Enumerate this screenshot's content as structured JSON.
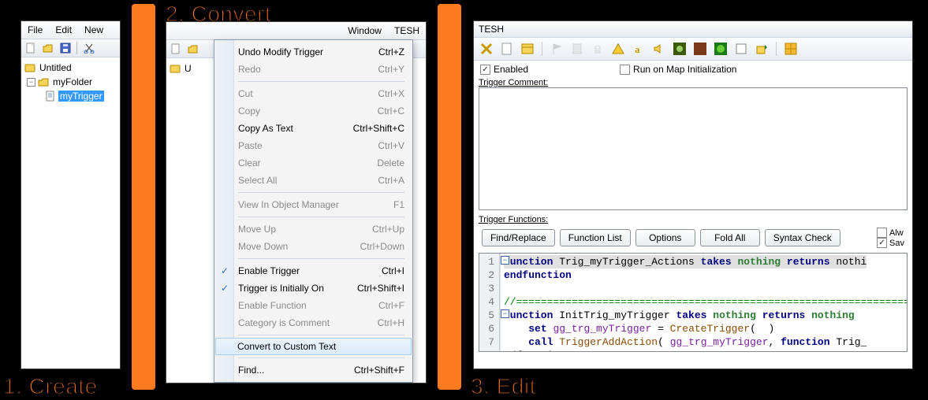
{
  "steps": {
    "s1": "1. Create",
    "s2": "2. Convert",
    "s3": "3. Edit"
  },
  "panel1": {
    "menubar": [
      "File",
      "Edit",
      "New"
    ],
    "tree": {
      "root": "Untitled",
      "folder": "myFolder",
      "trigger": "myTrigger"
    }
  },
  "panel2": {
    "menubar_right": [
      "Window",
      "TESH"
    ],
    "menu": [
      {
        "label": "Undo Modify Trigger",
        "shortcut": "Ctrl+Z",
        "disabled": false
      },
      {
        "label": "Redo",
        "shortcut": "Ctrl+Y",
        "disabled": true
      },
      "---",
      {
        "label": "Cut",
        "shortcut": "Ctrl+X",
        "disabled": true
      },
      {
        "label": "Copy",
        "shortcut": "Ctrl+C",
        "disabled": true
      },
      {
        "label": "Copy As Text",
        "shortcut": "Ctrl+Shift+C",
        "disabled": false
      },
      {
        "label": "Paste",
        "shortcut": "Ctrl+V",
        "disabled": true
      },
      {
        "label": "Clear",
        "shortcut": "Delete",
        "disabled": true
      },
      {
        "label": "Select All",
        "shortcut": "Ctrl+A",
        "disabled": true
      },
      "---",
      {
        "label": "View In Object Manager",
        "shortcut": "F1",
        "disabled": true
      },
      "---",
      {
        "label": "Move Up",
        "shortcut": "Ctrl+Up",
        "disabled": true
      },
      {
        "label": "Move Down",
        "shortcut": "Ctrl+Down",
        "disabled": true
      },
      "---",
      {
        "label": "Enable Trigger",
        "shortcut": "Ctrl+I",
        "disabled": false,
        "checked": true
      },
      {
        "label": "Trigger is Initially On",
        "shortcut": "Ctrl+Shift+I",
        "disabled": false,
        "checked": true
      },
      {
        "label": "Enable Function",
        "shortcut": "Ctrl+F",
        "disabled": true
      },
      {
        "label": "Category is Comment",
        "shortcut": "Ctrl+H",
        "disabled": true
      },
      "---",
      {
        "label": "Convert to Custom Text",
        "shortcut": "",
        "disabled": false,
        "highlight": true
      },
      "---",
      {
        "label": "Find...",
        "shortcut": "Ctrl+Shift+F",
        "disabled": false
      }
    ]
  },
  "panel3": {
    "title": "TESH",
    "enabled_label": "Enabled",
    "run_on_init_label": "Run on Map Initialization",
    "trigger_comment_label": "Trigger Comment:",
    "trigger_functions_label": "Trigger Functions:",
    "buttons": [
      "Find/Replace",
      "Function List",
      "Options",
      "Fold All",
      "Syntax Check"
    ],
    "right_checks": [
      "Alw",
      "Sav"
    ],
    "code": {
      "lines": [
        {
          "n": 1,
          "raw": "function Trig_myTrigger_Actions takes nothing returns nothi"
        },
        {
          "n": 2,
          "raw": "endfunction"
        },
        {
          "n": 3,
          "raw": ""
        },
        {
          "n": 4,
          "raw": "//==================================================================="
        },
        {
          "n": 5,
          "raw": "function InitTrig_myTrigger takes nothing returns nothing"
        },
        {
          "n": 6,
          "raw": "    set gg_trg_myTrigger = CreateTrigger(  )"
        },
        {
          "n": 7,
          "raw": "    call TriggerAddAction( gg_trg_myTrigger, function Trig_"
        }
      ],
      "last_visible": "ndfunction"
    }
  }
}
